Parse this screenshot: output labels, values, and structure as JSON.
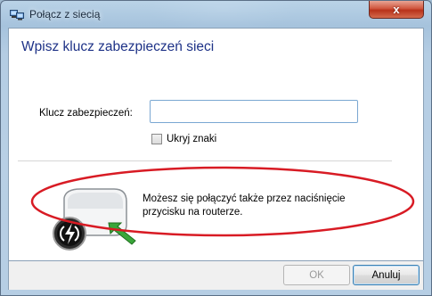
{
  "window": {
    "title": "Połącz z siecią",
    "close_label": "x"
  },
  "dialog": {
    "heading": "Wpisz klucz zabezpieczeń sieci",
    "key_label": "Klucz zabezpieczeń:",
    "key_value": "",
    "hide_chars_label": "Ukryj znaki",
    "hide_chars_checked": false,
    "wps_text": "Możesz się połączyć także przez naciśnięcie przycisku na routerze."
  },
  "buttons": {
    "ok_label": "OK",
    "cancel_label": "Anuluj"
  },
  "colors": {
    "heading": "#1e3287",
    "annotation_ellipse": "#d81b24",
    "wps_arrow": "#3aa63a"
  },
  "icons": {
    "title": "network-icon",
    "router": "router-wps-icon",
    "arrow": "green-arrow-icon"
  }
}
